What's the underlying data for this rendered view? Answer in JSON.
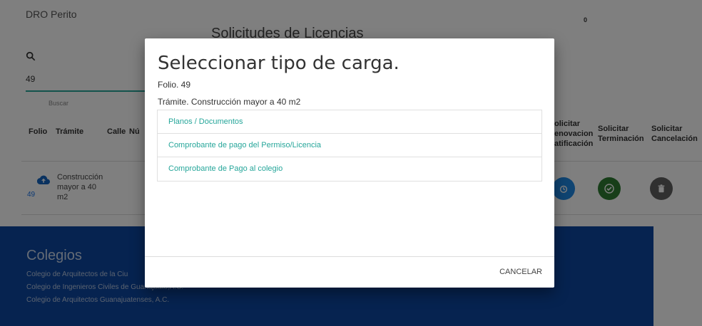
{
  "app": {
    "user": "DRO Perito",
    "badge_count": "0"
  },
  "page": {
    "heading": "Solicitudes de Licencias"
  },
  "search": {
    "value": "49",
    "label": "Buscar"
  },
  "table": {
    "headers": {
      "folio": "Folio",
      "tramite": "Trámite",
      "calle": "Calle",
      "numero": "Nú",
      "renovacion": "olicitar enovacion atificación",
      "terminacion": "Solicitar Terminación",
      "cancelacion": "Solicitar Cancelación"
    },
    "rows": [
      {
        "folio": "49",
        "tramite": "Construcción mayor a 40 m2"
      }
    ]
  },
  "colors": {
    "renovacion": "#1e88e5",
    "terminacion": "#2e7d32",
    "cancelacion": "#616161",
    "accent": "#26a69a",
    "footer": "#0d47a1"
  },
  "footer": {
    "title": "Colegios",
    "lines": [
      "Colegio de Arquitectos de la Ciu",
      "Colegio de Ingenieros Civiles de Guanajuato,A.C.",
      "Colegio de Arquitectos Guanajuatenses, A.C."
    ]
  },
  "modal": {
    "title": "Seleccionar tipo de carga.",
    "folio": "Folio. 49",
    "tramite": "Trámite. Construcción mayor a 40 m2",
    "options": [
      "Planos / Documentos",
      "Comprobante de pago del Permiso/Licencia",
      "Comprobante de Pago al colegio"
    ],
    "cancel_label": "CANCELAR"
  }
}
